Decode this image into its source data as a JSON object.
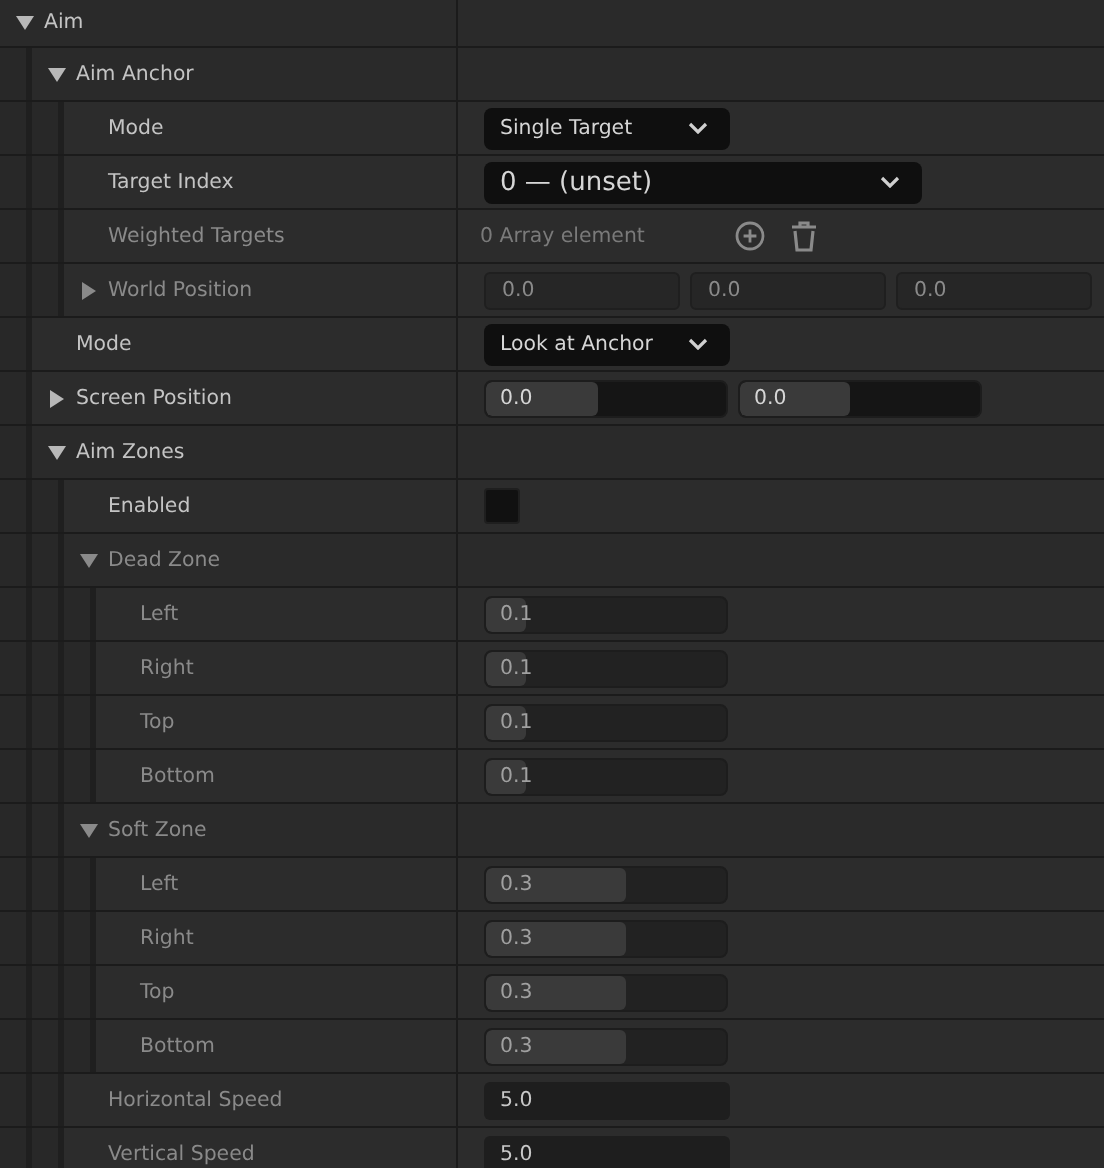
{
  "rows": [
    {
      "label": "Aim",
      "kind": "group",
      "expanded": true,
      "children": [
        {
          "label": "Aim Anchor",
          "kind": "group",
          "expanded": true,
          "children": [
            {
              "label": "Mode",
              "kind": "dropdown",
              "value": "Single Target"
            },
            {
              "label": "Target Index",
              "kind": "picker",
              "value": "0 — (unset)"
            },
            {
              "label": "Weighted Targets",
              "kind": "array",
              "disabled": true,
              "value": "0 Array element"
            },
            {
              "label": "World Position",
              "kind": "vector",
              "disabled": true,
              "expanded": false,
              "fields": [
                {
                  "value": "0.0"
                },
                {
                  "value": "0.0"
                },
                {
                  "value": "0.0"
                }
              ]
            }
          ]
        },
        {
          "label": "Mode",
          "kind": "dropdown",
          "value": "Look at Anchor"
        },
        {
          "label": "Screen Position",
          "kind": "sliders",
          "expanded": false,
          "fields": [
            {
              "value": "0.0",
              "level": 0.47
            },
            {
              "value": "0.0",
              "level": 0.46
            }
          ]
        },
        {
          "label": "Aim Zones",
          "kind": "group",
          "expanded": true,
          "children": [
            {
              "label": "Enabled",
              "kind": "checkbox",
              "checked": false
            },
            {
              "label": "Dead Zone",
              "kind": "group",
              "expanded": true,
              "disabled": true,
              "children": [
                {
                  "label": "Left",
                  "kind": "sliders",
                  "disabled": true,
                  "fields": [
                    {
                      "value": "0.1",
                      "level": 0.17
                    }
                  ]
                },
                {
                  "label": "Right",
                  "kind": "sliders",
                  "disabled": true,
                  "fields": [
                    {
                      "value": "0.1",
                      "level": 0.17
                    }
                  ]
                },
                {
                  "label": "Top",
                  "kind": "sliders",
                  "disabled": true,
                  "fields": [
                    {
                      "value": "0.1",
                      "level": 0.17
                    }
                  ]
                },
                {
                  "label": "Bottom",
                  "kind": "sliders",
                  "disabled": true,
                  "fields": [
                    {
                      "value": "0.1",
                      "level": 0.17
                    }
                  ]
                }
              ]
            },
            {
              "label": "Soft Zone",
              "kind": "group",
              "expanded": true,
              "disabled": true,
              "children": [
                {
                  "label": "Left",
                  "kind": "sliders",
                  "disabled": true,
                  "fields": [
                    {
                      "value": "0.3",
                      "level": 0.58
                    }
                  ]
                },
                {
                  "label": "Right",
                  "kind": "sliders",
                  "disabled": true,
                  "fields": [
                    {
                      "value": "0.3",
                      "level": 0.58
                    }
                  ]
                },
                {
                  "label": "Top",
                  "kind": "sliders",
                  "disabled": true,
                  "fields": [
                    {
                      "value": "0.3",
                      "level": 0.58
                    }
                  ]
                },
                {
                  "label": "Bottom",
                  "kind": "sliders",
                  "disabled": true,
                  "fields": [
                    {
                      "value": "0.3",
                      "level": 0.58
                    }
                  ]
                }
              ]
            },
            {
              "label": "Horizontal Speed",
              "kind": "number",
              "disabled": true,
              "value": "5.0"
            },
            {
              "label": "Vertical Speed",
              "kind": "number",
              "disabled": true,
              "value": "5.0"
            }
          ]
        }
      ]
    }
  ]
}
